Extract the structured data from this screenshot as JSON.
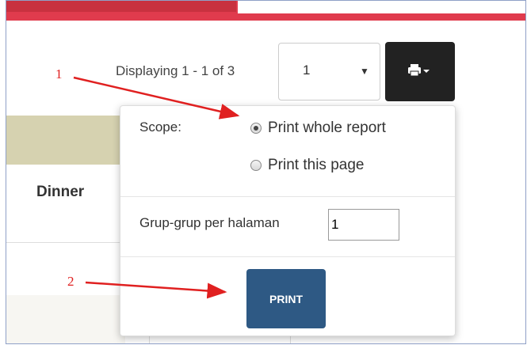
{
  "pager": {
    "displaying": "Displaying 1 - 1 of 3",
    "selected_page": "1"
  },
  "table": {
    "column_dinner": "Dinner"
  },
  "popup": {
    "scope_label": "Scope:",
    "options": [
      {
        "label": "Print whole report",
        "checked": true
      },
      {
        "label": "Print this page",
        "checked": false
      }
    ],
    "groups_label": "Grup-grup per halaman",
    "groups_value": "1",
    "print_button": "PRINT"
  },
  "annotations": {
    "one": "1",
    "two": "2",
    "arrow_color": "#e02020"
  },
  "colors": {
    "top_bar": "#e03b4d",
    "print_button": "#2e5984",
    "toolbar_button": "#222222"
  },
  "icons": {
    "toolbar": "printer-icon",
    "dropdown": "caret-down-icon"
  }
}
